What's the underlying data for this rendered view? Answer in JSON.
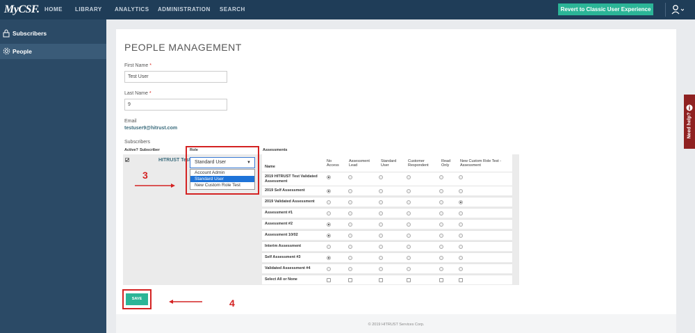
{
  "nav": {
    "logo": "MyCSF.",
    "links": [
      "HOME",
      "LIBRARY",
      "ANALYTICS",
      "ADMINISTRATION",
      "SEARCH"
    ],
    "revert_label": "Revert to Classic User Experience"
  },
  "sidebar": {
    "items": [
      {
        "label": "Subscribers",
        "icon": "lock-icon"
      },
      {
        "label": "People",
        "icon": "gear-icon"
      }
    ]
  },
  "page": {
    "title": "PEOPLE MANAGEMENT",
    "first_name_label": "First Name",
    "first_name_value": "Test User",
    "last_name_label": "Last Name",
    "last_name_value": "9",
    "required_mark": "*",
    "email_label": "Email",
    "email_value": "testuser9@hitrust.com",
    "subscribers_label": "Subscribers"
  },
  "subscribers": {
    "headers": {
      "active": "Active?",
      "subscriber": "Subscriber",
      "role": "Role",
      "assessments": "Assessments"
    },
    "row": {
      "active": true,
      "subscriber": "HITRUST Test",
      "role": "Standard User"
    },
    "role_options": [
      "Account Admin",
      "Standard User",
      "New Custom Role Test"
    ],
    "role_selected_index": 1
  },
  "assessments": {
    "columns": [
      "Name",
      "No Access",
      "Assessment Lead",
      "Standard User",
      "Customer Respondent",
      "Read Only",
      "New Custom Role Test - Assessment"
    ],
    "rows": [
      {
        "name": "2019 HITRUST Test Validated Assessment",
        "selected": 0
      },
      {
        "name": "2019 Self Assessment",
        "selected": 0
      },
      {
        "name": "2019 Validated Assessment",
        "selected": 5
      },
      {
        "name": "Assessment #1",
        "selected": -1
      },
      {
        "name": "Assessment #2",
        "selected": 0
      },
      {
        "name": "Assessment 10/02",
        "selected": 0
      },
      {
        "name": "Interim Assessment",
        "selected": -1
      },
      {
        "name": "Self Assessment #3",
        "selected": 0
      },
      {
        "name": "Validated Assessment #4",
        "selected": -1
      }
    ],
    "select_all_label": "Select All or None"
  },
  "actions": {
    "save_label": "SAVE"
  },
  "annotations": {
    "step3": "3",
    "step4": "4"
  },
  "help": {
    "label": "Need help?"
  },
  "footer": {
    "text": "© 2019 HITRUST Services Corp."
  },
  "colors": {
    "nav": "#1f3d58",
    "sidebar": "#2b4a66",
    "accent": "#2bb597",
    "annotation": "#d42222",
    "link": "#3a6b7c"
  }
}
